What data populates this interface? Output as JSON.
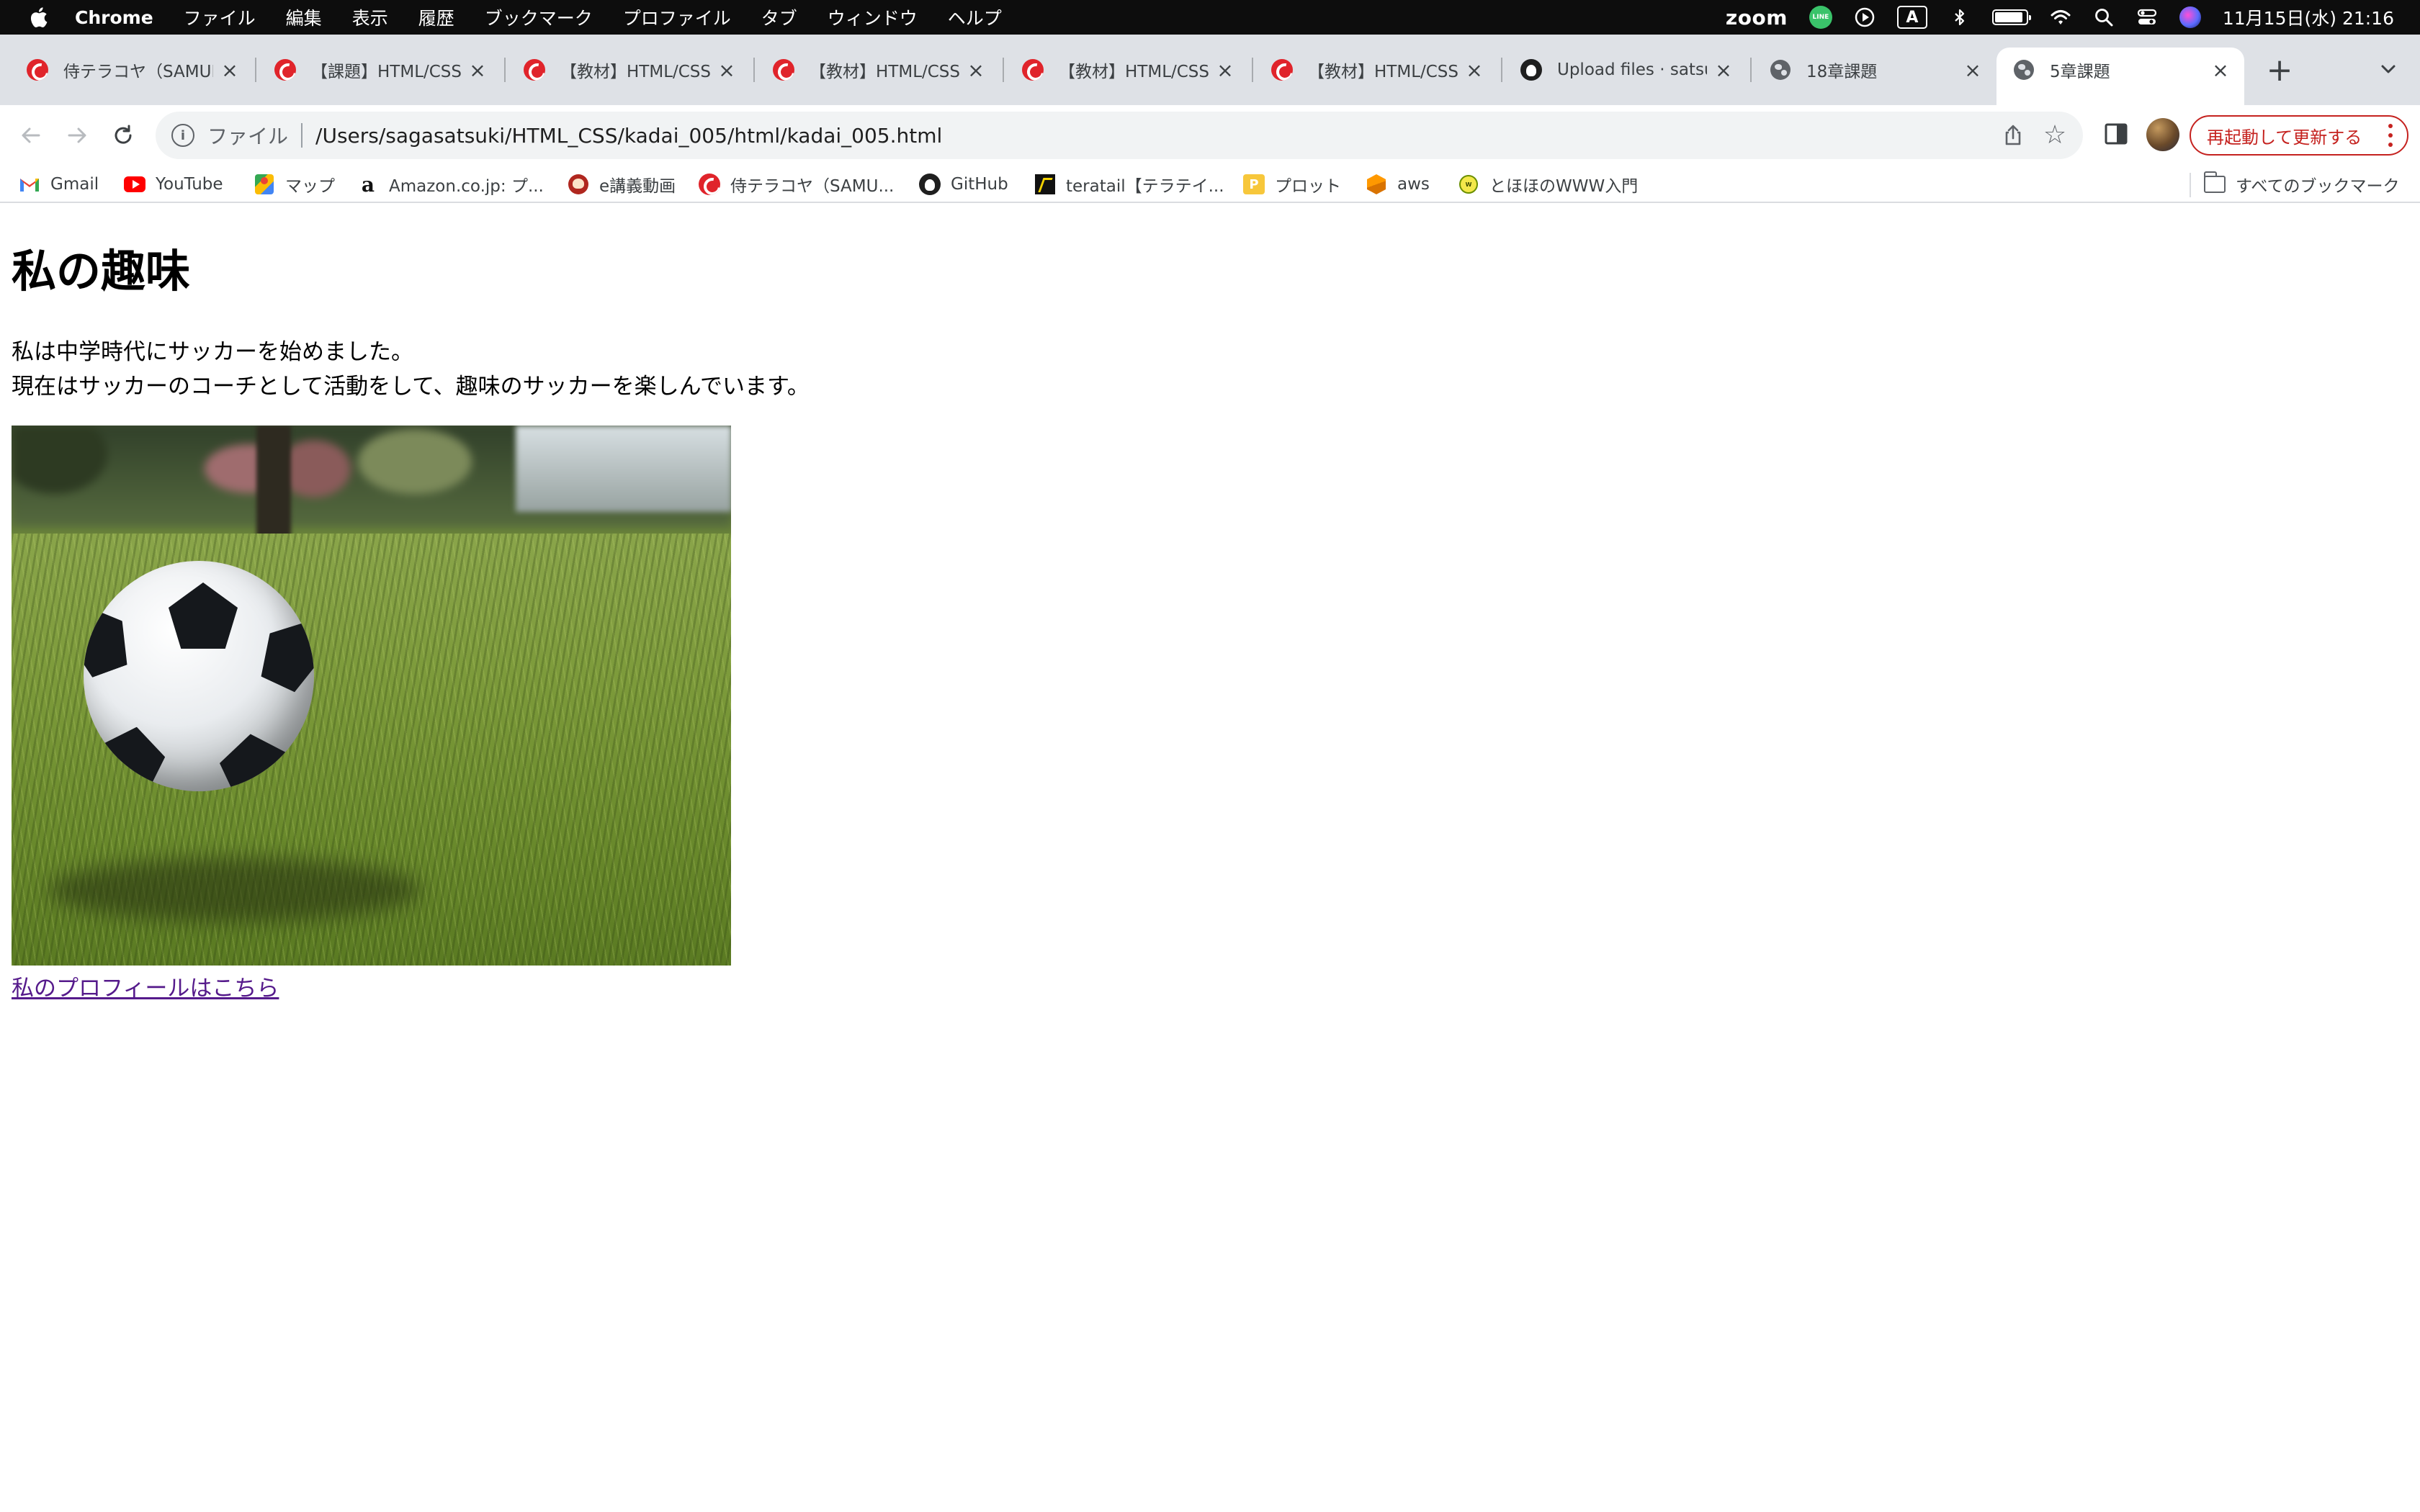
{
  "menubar": {
    "app_name": "Chrome",
    "menus": [
      "ファイル",
      "編集",
      "表示",
      "履歴",
      "ブックマーク",
      "プロファイル",
      "タブ",
      "ウィンドウ",
      "ヘルプ"
    ],
    "zoom_label": "zoom",
    "line_label": "LINE",
    "ime_label": "A",
    "clock": "11月15日(水) 21:16"
  },
  "tabs": [
    {
      "title": "侍テラコヤ（SAMURAI",
      "icon": "samurai-icon",
      "active": false
    },
    {
      "title": "【課題】HTML/CSS",
      "icon": "samurai-icon",
      "active": false
    },
    {
      "title": "【教材】HTML/CSS",
      "icon": "samurai-icon",
      "active": false
    },
    {
      "title": "【教材】HTML/CSS",
      "icon": "samurai-icon",
      "active": false
    },
    {
      "title": "【教材】HTML/CSS",
      "icon": "samurai-icon",
      "active": false
    },
    {
      "title": "【教材】HTML/CSS",
      "icon": "samurai-icon",
      "active": false
    },
    {
      "title": "Upload files · satsu",
      "icon": "github-icon",
      "active": false
    },
    {
      "title": "18章課題",
      "icon": "globe-icon",
      "active": false
    },
    {
      "title": "5章課題",
      "icon": "globe-icon",
      "active": true
    }
  ],
  "toolbar": {
    "scheme_label": "ファイル",
    "url": "/Users/sagasatsuki/HTML_CSS/kadai_005/html/kadai_005.html",
    "relaunch_label": "再起動して更新する"
  },
  "bookmarks": [
    {
      "label": "Gmail",
      "icon": "gmail-icon"
    },
    {
      "label": "YouTube",
      "icon": "youtube-icon"
    },
    {
      "label": "マップ",
      "icon": "maps-icon"
    },
    {
      "label": "Amazon.co.jp: プ...",
      "icon": "amazon-icon"
    },
    {
      "label": "e講義動画",
      "icon": "e-lecture-icon"
    },
    {
      "label": "侍テラコヤ（SAMU...",
      "icon": "samurai-icon"
    },
    {
      "label": "GitHub",
      "icon": "github-icon"
    },
    {
      "label": "teratail【テラテイ...",
      "icon": "teratail-icon"
    },
    {
      "label": "プロット",
      "icon": "plot-icon"
    },
    {
      "label": "aws",
      "icon": "aws-icon"
    },
    {
      "label": "とほほのWWW入門",
      "icon": "www-icon"
    }
  ],
  "all_bookmarks_label": "すべてのブックマーク",
  "content": {
    "heading": "私の趣味",
    "line1": "私は中学時代にサッカーを始めました。",
    "line2": "現在はサッカーのコーチとして活動をして、趣味のサッカーを楽しんでいます。",
    "link_text": "私のプロフィールはこちら"
  },
  "colors": {
    "menubar_bg": "#0d0d0d",
    "tabstrip_bg": "#dee1e6",
    "omnibox_bg": "#f1f3f4",
    "relaunch_red": "#c5221f",
    "visited_link": "#551a8b"
  }
}
